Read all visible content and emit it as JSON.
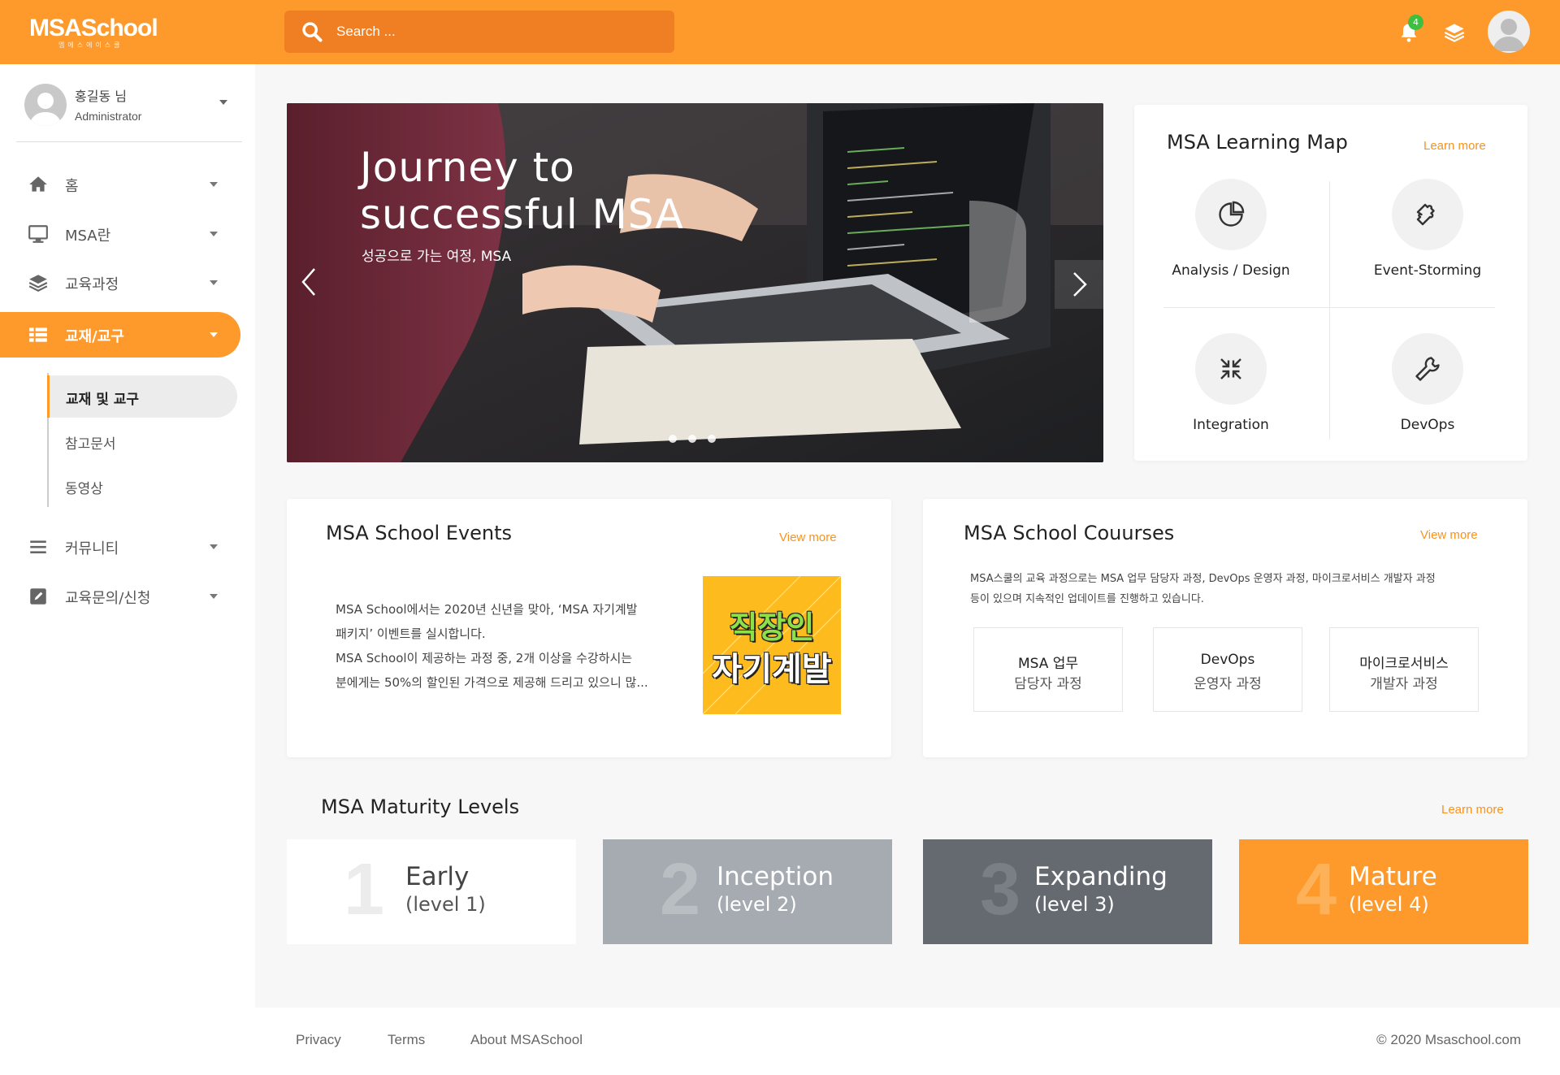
{
  "brand": {
    "logo": "MSASchool",
    "logo_sub": "엠에스에이스쿨"
  },
  "search": {
    "placeholder": "Search ..."
  },
  "notifications": {
    "count": "4"
  },
  "colors": {
    "accent": "#fd9a2b",
    "accent_dark": "#f07e22",
    "link": "#f7931e",
    "badge": "#3fbf3f"
  },
  "profile": {
    "name": "홍길동 님",
    "role": "Administrator"
  },
  "sidebar": {
    "items": [
      {
        "label": "홈",
        "icon": "home-icon"
      },
      {
        "label": "MSA란",
        "icon": "monitor-icon"
      },
      {
        "label": "교육과정",
        "icon": "layers-icon"
      },
      {
        "label": "교재/교구",
        "icon": "list-icon"
      },
      {
        "label": "커뮤니티",
        "icon": "menu-icon"
      },
      {
        "label": "교육문의/신청",
        "icon": "edit-icon"
      }
    ],
    "subitems": [
      {
        "label": "교재 및 교구"
      },
      {
        "label": "참고문서"
      },
      {
        "label": "동영상"
      }
    ]
  },
  "hero": {
    "title_line1": "Journey to",
    "title_line2": "successful MSA",
    "subtitle": "성공으로 가는 여정, MSA"
  },
  "learning_map": {
    "title": "MSA Learning Map",
    "link": "Learn more",
    "items": [
      {
        "label": "Analysis / Design",
        "icon": "pie-chart-icon"
      },
      {
        "label": "Event-Storming",
        "icon": "puzzle-icon"
      },
      {
        "label": "Integration",
        "icon": "compress-arrows-icon"
      },
      {
        "label": "DevOps",
        "icon": "wrench-icon"
      }
    ]
  },
  "events": {
    "title": "MSA School Events",
    "link": "View more",
    "text_line1": "MSA School에서는 2020년 신년을 맞아, ‘MSA 자기계발",
    "text_line2": "패키지’ 이벤트를 실시합니다.",
    "text_line3": "MSA School이 제공하는 과정 중, 2개 이상을 수강하시는",
    "text_line4": "분에게는 50%의 할인된 가격으로 제공해 드리고 있으니 많...",
    "image_line1": "직장인",
    "image_line2": "자기계발"
  },
  "courses": {
    "title": "MSA School Couurses",
    "link": "View more",
    "desc_line1": "MSA스쿨의 교육 과정으로는 MSA 업무 담당자 과정, DevOps 운영자 과정, 마이크로서비스 개발자 과정",
    "desc_line2": "등이 있으며 지속적인 업데이트를 진행하고 있습니다.",
    "items": [
      {
        "line1": "MSA 업무",
        "line2": "담당자 과정"
      },
      {
        "line1": "DevOps",
        "line2": "운영자 과정"
      },
      {
        "line1": "마이크로서비스",
        "line2": "개발자 과정"
      }
    ]
  },
  "maturity": {
    "title": "MSA Maturity Levels",
    "link": "Learn more",
    "levels": [
      {
        "num": "1",
        "name": "Early",
        "sub": "(level 1)"
      },
      {
        "num": "2",
        "name": "Inception",
        "sub": "(level 2)"
      },
      {
        "num": "3",
        "name": "Expanding",
        "sub": "(level 3)"
      },
      {
        "num": "4",
        "name": "Mature",
        "sub": "(level 4)"
      }
    ]
  },
  "footer": {
    "links": [
      "Privacy",
      "Terms",
      "About MSASchool"
    ],
    "copyright": "© 2020 Msaschool.com"
  }
}
